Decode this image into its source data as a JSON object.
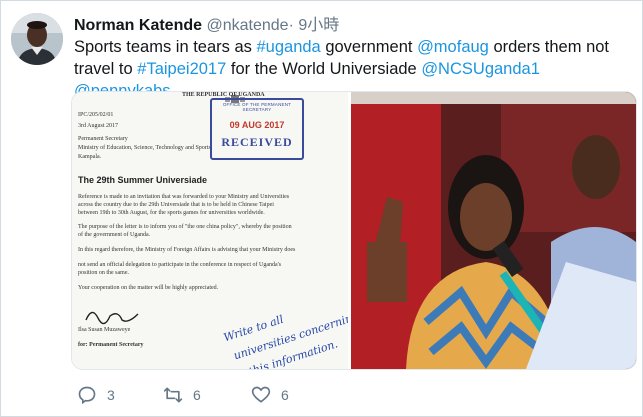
{
  "tweet": {
    "display_name": "Norman Katende",
    "handle": "@nkatende",
    "timestamp": "· 9小時",
    "text_parts": [
      {
        "t": "Sports teams in tears as ",
        "link": false
      },
      {
        "t": "#uganda",
        "link": true
      },
      {
        "t": " government ",
        "link": false
      },
      {
        "t": "@mofaug",
        "link": true
      },
      {
        "t": " orders them not travel to ",
        "link": false
      },
      {
        "t": "#Taipei2017",
        "link": true
      },
      {
        "t": "  for the World Universiade ",
        "link": false
      },
      {
        "t": "@NCSUganda1",
        "link": true
      },
      {
        "t": " ",
        "link": false
      },
      {
        "t": "@pennykabs",
        "link": true
      }
    ]
  },
  "document": {
    "header_line": "THE REPUBLIC OF UGANDA",
    "ref_line": "IPC/205/02/01",
    "date_line": "3rd August 2017",
    "addressee": [
      "Permanent Secretary",
      "Ministry of Education, Science, Technology and Sports",
      "Kampala."
    ],
    "heading": "The 29th Summer Universiade",
    "body": [
      "Reference is made to an invitation that was forwarded to your Ministry and Universities",
      "across the country due to the 29th Universiade that is to be held in Chinese Taipei",
      "between 19th to 30th August,  for the sports games for universities worldwide.",
      "The purpose of the letter is to inform you of \"the one china policy\", whereby the position",
      "of the government of Uganda.",
      "In this regard therefore, the Ministry of Foreign Affairs is advising that your Ministry does",
      "not send an official delegation to participate in the conference in respect of Uganda's",
      "position on the same.",
      "Your cooperation on the matter will be highly appreciated."
    ],
    "signatory": "Ilsa Susan Muzaweye",
    "signatory_title": "for: Permanent Secretary",
    "stamp": {
      "top": "OFFICE OF THE PERMANENT SECRETARY",
      "date": "09 AUG 2017",
      "label": "RECEIVED"
    },
    "handwriting": [
      "Write to all",
      "universities concerning",
      "this information."
    ]
  },
  "actions": {
    "reply_count": "3",
    "retweet_count": "6",
    "like_count": "6"
  },
  "colors": {
    "link": "#1b95e0",
    "muted": "#657786",
    "text": "#14171a"
  }
}
